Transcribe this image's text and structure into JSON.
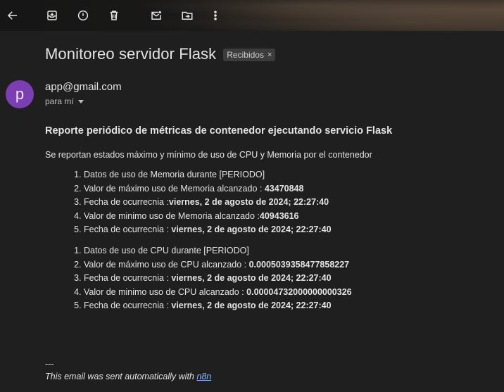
{
  "toolbar": {
    "buttons": [
      {
        "name": "back-arrow-icon"
      },
      {
        "name": "archive-icon"
      },
      {
        "name": "report-spam-icon"
      },
      {
        "name": "delete-icon"
      },
      {
        "name": "mark-unread-icon"
      },
      {
        "name": "move-to-icon"
      },
      {
        "name": "more-options-icon"
      }
    ]
  },
  "email": {
    "subject": "Monitoreo servidor Flask",
    "label": "Recibidos",
    "label_remove": "×",
    "sender_initial": "p",
    "sender": "app@gmail.com",
    "to": "para mí",
    "heading": "Reporte periódico de métricas de contenedor ejecutando servicio Flask",
    "intro": "Se reportan estados máximo y mínimo de uso de CPU y Memoria por el contenedor",
    "memory_list": [
      {
        "text": "Datos de uso de Memoria durante [PERIODO]",
        "value": ""
      },
      {
        "text": "Valor de máximo uso de Memoria alcanzado : ",
        "value": "43470848"
      },
      {
        "text": "Fecha de ocurrecnia :",
        "value": "viernes, 2 de agosto de 2024; 22:27:40"
      },
      {
        "text": "Valor de minimo uso de Memoria alcanzado :",
        "value": "40943616"
      },
      {
        "text": "Fecha de ocurrecnia : ",
        "value": "viernes, 2 de agosto de 2024; 22:27:40"
      }
    ],
    "cpu_list": [
      {
        "text": "Datos de uso de CPU durante [PERIODO]",
        "value": ""
      },
      {
        "text": "Valor de máximo uso de CPU alcanzado : ",
        "value": "0.0005039358477858227"
      },
      {
        "text": "Fecha de ocurrecnia : ",
        "value": "viernes, 2 de agosto de 2024; 22:27:40"
      },
      {
        "text": "Valor de minimo uso de CPU alcanzado : ",
        "value": "0.00004732000000000326"
      },
      {
        "text": "Fecha de ocurrecnia : ",
        "value": "viernes, 2 de agosto de 2024; 22:27:40"
      }
    ],
    "footer_dashes": "---",
    "footer_text": "This email was sent automatically with ",
    "footer_link": "n8n"
  }
}
